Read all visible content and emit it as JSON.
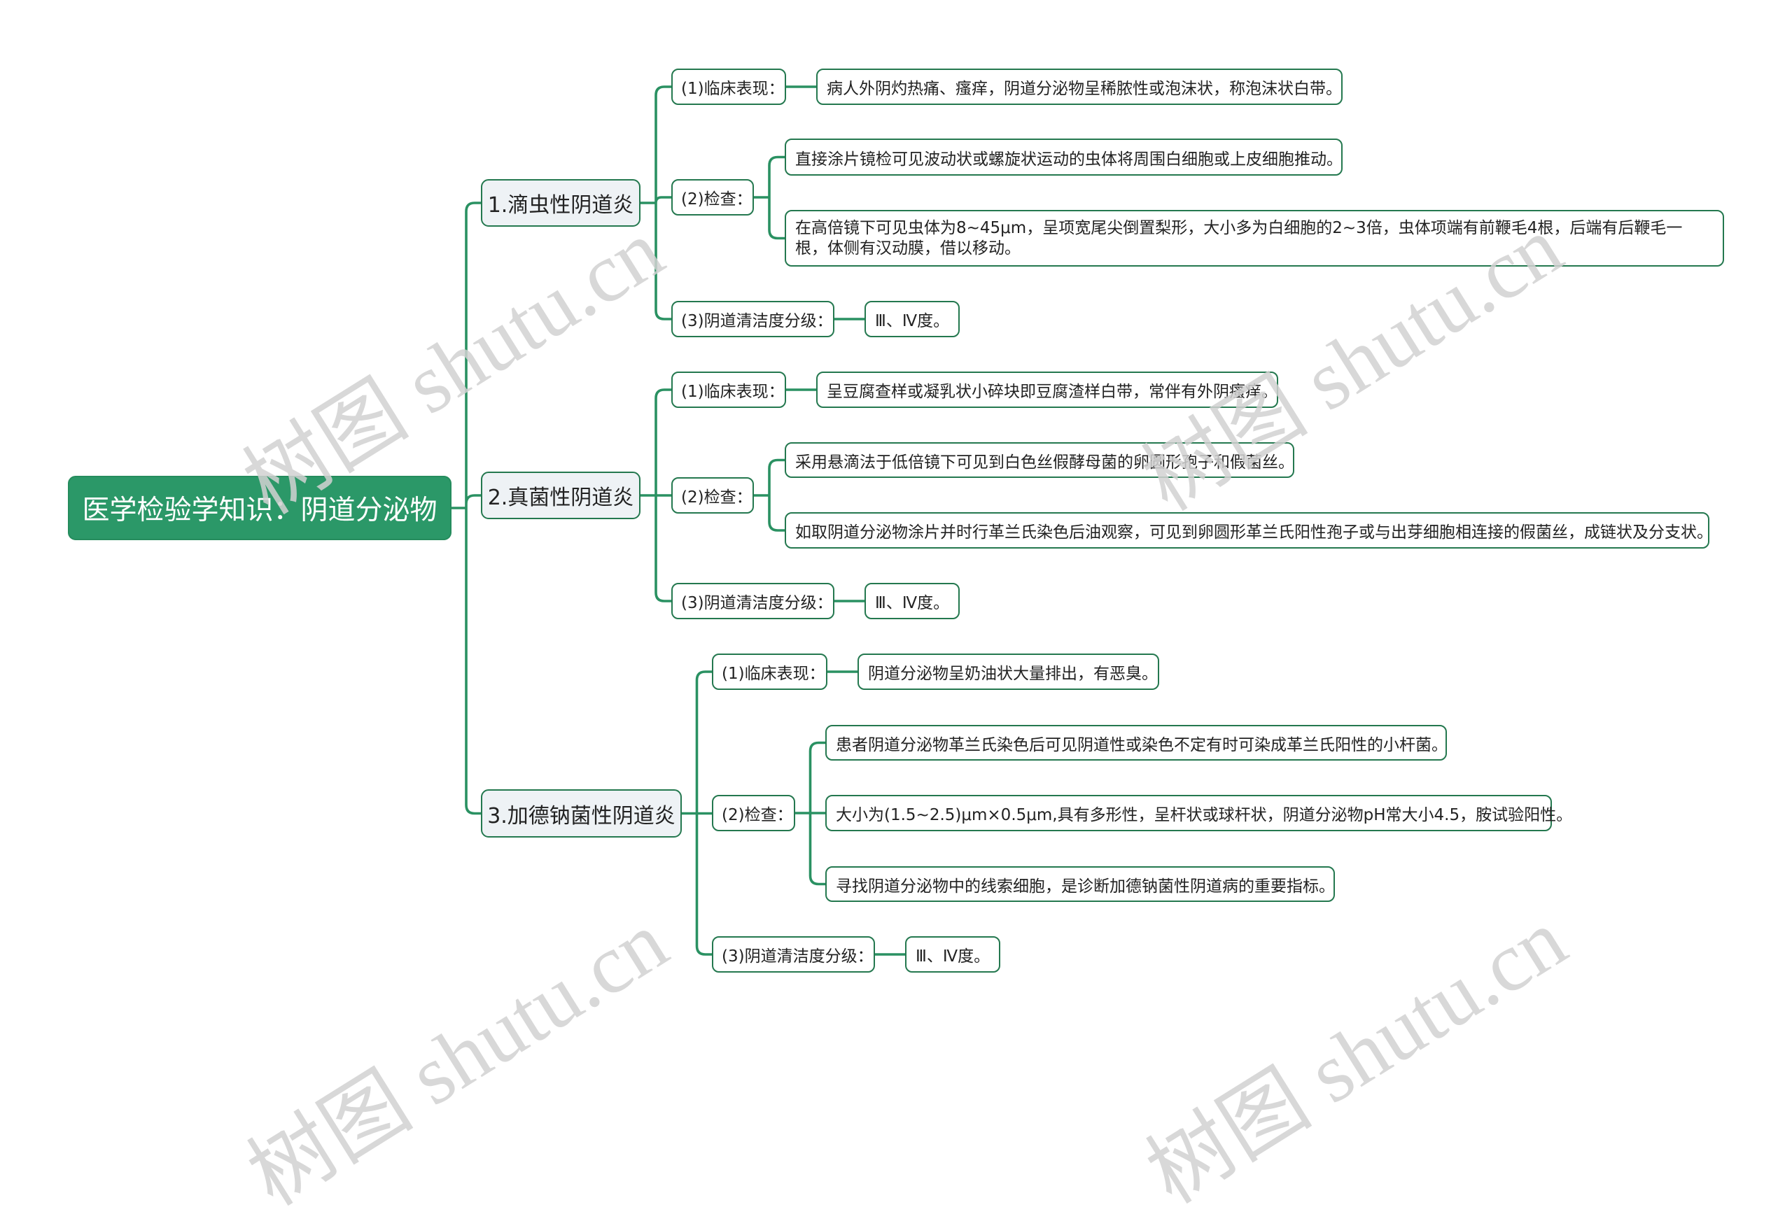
{
  "central_topic": "医学检验学知识：阴道分泌物",
  "branches": [
    {
      "label": "1.滴虫性阴道炎",
      "items": [
        {
          "label": "(1)临床表现：",
          "details": [
            "病人外阴灼热痛、瘙痒，阴道分泌物呈稀脓性或泡沫状，称泡沫状白带。"
          ]
        },
        {
          "label": "(2)检查：",
          "details": [
            "直接涂片镜检可见波动状或螺旋状运动的虫体将周围白细胞或上皮细胞推动。",
            "在高倍镜下可见虫体为8~45μm，呈项宽尾尖倒置梨形，大小多为白细胞的2~3倍，虫体项端有前鞭毛4根，后端有后鞭毛一根，体侧有汉动膜，借以移动。"
          ]
        },
        {
          "label": "(3)阴道清洁度分级：",
          "details": [
            "Ⅲ、Ⅳ度。"
          ]
        }
      ]
    },
    {
      "label": "2.真菌性阴道炎",
      "items": [
        {
          "label": "(1)临床表现：",
          "details": [
            "呈豆腐查样或凝乳状小碎块即豆腐渣样白带，常伴有外阴瘙痒。"
          ]
        },
        {
          "label": "(2)检查：",
          "details": [
            "采用悬滴法于低倍镜下可见到白色丝假酵母菌的卵圆形孢子和假菌丝。",
            "如取阴道分泌物涂片并时行革兰氏染色后油观察，可见到卵圆形革兰氏阳性孢子或与出芽细胞相连接的假菌丝，成链状及分支状。"
          ]
        },
        {
          "label": "(3)阴道清洁度分级：",
          "details": [
            "Ⅲ、Ⅳ度。"
          ]
        }
      ]
    },
    {
      "label": "3.加德钠菌性阴道炎",
      "items": [
        {
          "label": "(1)临床表现：",
          "details": [
            "阴道分泌物呈奶油状大量排出，有恶臭。"
          ]
        },
        {
          "label": "(2)检查：",
          "details": [
            "患者阴道分泌物革兰氏染色后可见阴道性或染色不定有时可染成革兰氏阳性的小杆菌。",
            "大小为(1.5~2.5)μm×0.5μm,具有多形性，呈杆状或球杆状，阴道分泌物pH常大小4.5，胺试验阳性。",
            "寻找阴道分泌物中的线索细胞，是诊断加德钠菌性阴道病的重要指标。"
          ]
        },
        {
          "label": "(3)阴道清洁度分级：",
          "details": [
            "Ⅲ、Ⅳ度。"
          ]
        }
      ]
    }
  ],
  "watermark": "树图 shutu.cn",
  "colors": {
    "central_fill": "#2b9868",
    "connector": "#2a9162",
    "node_border": "#24784f",
    "topic_fill": "#eef2f5",
    "text": "#222222",
    "watermark": "#d2d2d2"
  }
}
